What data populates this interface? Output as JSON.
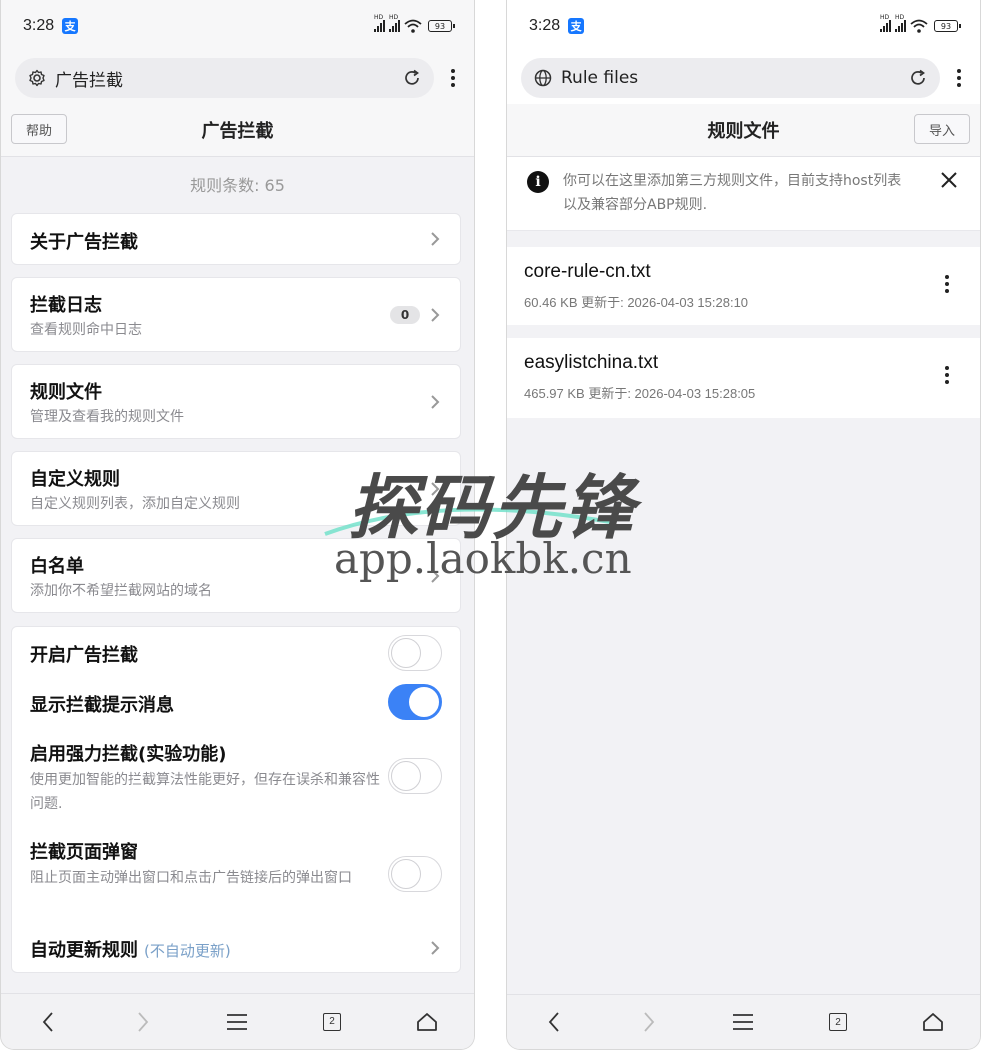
{
  "status": {
    "time": "3:28",
    "battery": "93"
  },
  "left": {
    "url": "广告拦截",
    "header": {
      "title": "广告拦截",
      "help_label": "帮助"
    },
    "rule_count": "规则条数: 65",
    "items": {
      "about": {
        "title": "关于广告拦截"
      },
      "log": {
        "title": "拦截日志",
        "subtitle": "查看规则命中日志",
        "badge": "0"
      },
      "rules": {
        "title": "规则文件",
        "subtitle": "管理及查看我的规则文件"
      },
      "custom": {
        "title": "自定义规则",
        "subtitle": "自定义规则列表，添加自定义规则"
      },
      "whitelist": {
        "title": "白名单",
        "subtitle": "添加你不希望拦截网站的域名"
      }
    },
    "settings": {
      "enable": {
        "title": "开启广告拦截",
        "on": false
      },
      "show_tips": {
        "title": "显示拦截提示消息",
        "on": true
      },
      "strong": {
        "title": "启用强力拦截(实验功能)",
        "subtitle": "使用更加智能的拦截算法性能更好，但存在误杀和兼容性问题.",
        "on": false
      },
      "popup": {
        "title": "拦截页面弹窗",
        "subtitle": "阻止页面主动弹出窗口和点击广告链接后的弹出窗口",
        "on": false
      },
      "auto_update": {
        "title": "自动更新规则",
        "value": "(不自动更新)"
      }
    },
    "nav_tabs_count": "2"
  },
  "right": {
    "url": "Rule files",
    "header": {
      "title": "规则文件",
      "import_label": "导入"
    },
    "notice": "你可以在这里添加第三方规则文件，目前支持host列表以及兼容部分ABP规则.",
    "files": [
      {
        "name": "core-rule-cn.txt",
        "meta": "60.46 KB 更新于: 2026-04-03 15:28:10"
      },
      {
        "name": "easylistchina.txt",
        "meta": "465.97 KB 更新于: 2026-04-03 15:28:05"
      }
    ],
    "nav_tabs_count": "2"
  },
  "watermark": {
    "brand": "探码先锋",
    "url": "app.laokbk.cn"
  },
  "colors": {
    "accent": "#3b82f6",
    "alipay": "#1677ff"
  }
}
